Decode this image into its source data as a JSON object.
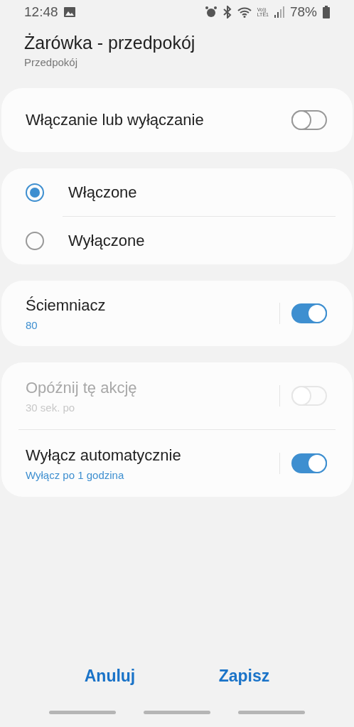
{
  "status_bar": {
    "time": "12:48",
    "network": [
      "Vo))",
      "LTE1"
    ],
    "battery": "78%"
  },
  "header": {
    "title": "Żarówka - przedpokój",
    "subtitle": "Przedpokój"
  },
  "power_toggle": {
    "label": "Włączanie lub wyłączanie",
    "on": false
  },
  "power_options": [
    {
      "label": "Włączone",
      "selected": true
    },
    {
      "label": "Wyłączone",
      "selected": false
    }
  ],
  "dimmer": {
    "label": "Ściemniacz",
    "value": "80",
    "on": true,
    "disabled": false
  },
  "timers": [
    {
      "label": "Opóźnij tę akcję",
      "value": "30 sek. po",
      "on": false,
      "disabled": true
    },
    {
      "label": "Wyłącz automatycznie",
      "value": "Wyłącz po 1 godzina",
      "on": true,
      "disabled": false
    }
  ],
  "buttons": [
    "Anuluj",
    "Zapisz"
  ]
}
